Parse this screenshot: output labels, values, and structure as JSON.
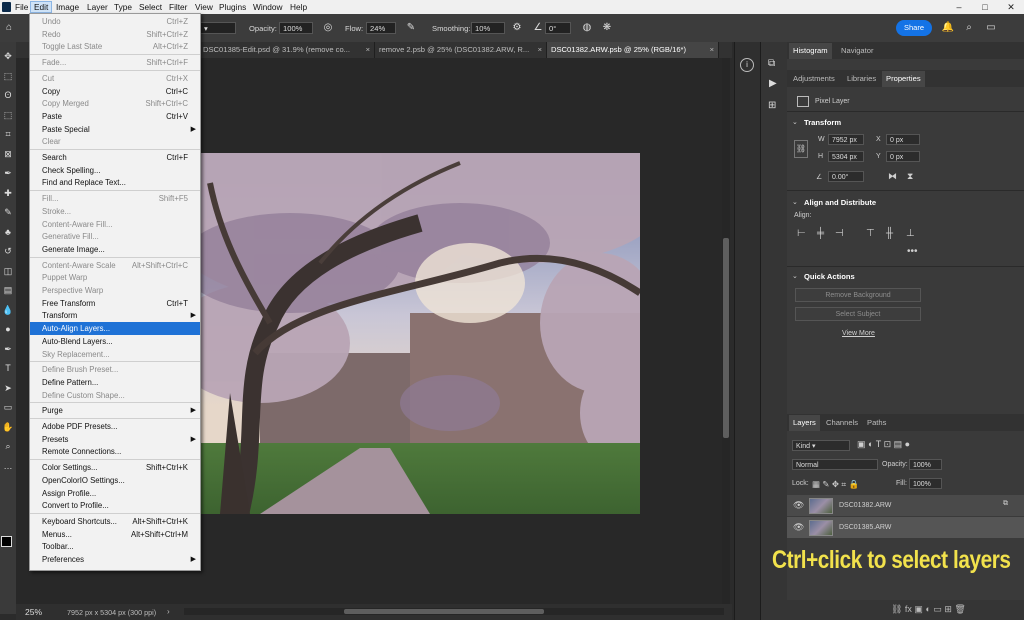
{
  "menubar": {
    "items": [
      "File",
      "Edit",
      "Image",
      "Layer",
      "Type",
      "Select",
      "Filter",
      "View",
      "Plugins",
      "Window",
      "Help"
    ],
    "window_controls": [
      "–",
      "□",
      "✕"
    ]
  },
  "options": {
    "opacity_label": "Opacity:",
    "opacity_value": "100%",
    "flow_label": "Flow:",
    "flow_value": "24%",
    "smoothing_label": "Smoothing:",
    "smoothing_value": "10%",
    "angle_value": "0°",
    "share_label": "Share"
  },
  "tabs": [
    {
      "label": "DSC01385-Edit.psd @ 31.9% (remove co...",
      "active": false
    },
    {
      "label": "remove 2.psb @ 25% (DSC01382.ARW, R...",
      "active": false
    },
    {
      "label": "DSC01382.ARW.psb @ 25% (RGB/16*)",
      "active": true
    }
  ],
  "status": {
    "zoom": "25%",
    "doc_info": "7952 px x 5304 px (300 ppi)"
  },
  "edit_menu": [
    {
      "label": "Undo",
      "shortcut": "Ctrl+Z",
      "disabled": true
    },
    {
      "label": "Redo",
      "shortcut": "Shift+Ctrl+Z",
      "disabled": true
    },
    {
      "label": "Toggle Last State",
      "shortcut": "Alt+Ctrl+Z",
      "disabled": true
    },
    {
      "sep": true
    },
    {
      "label": "Fade...",
      "shortcut": "Shift+Ctrl+F",
      "disabled": true
    },
    {
      "sep": true
    },
    {
      "label": "Cut",
      "shortcut": "Ctrl+X",
      "disabled": true
    },
    {
      "label": "Copy",
      "shortcut": "Ctrl+C",
      "disabled": false
    },
    {
      "label": "Copy Merged",
      "shortcut": "Shift+Ctrl+C",
      "disabled": true
    },
    {
      "label": "Paste",
      "shortcut": "Ctrl+V",
      "disabled": false
    },
    {
      "label": "Paste Special",
      "shortcut": "",
      "disabled": false,
      "submenu": true
    },
    {
      "label": "Clear",
      "shortcut": "",
      "disabled": true
    },
    {
      "sep": true
    },
    {
      "label": "Search",
      "shortcut": "Ctrl+F",
      "disabled": false
    },
    {
      "label": "Check Spelling...",
      "shortcut": "",
      "disabled": false
    },
    {
      "label": "Find and Replace Text...",
      "shortcut": "",
      "disabled": false
    },
    {
      "sep": true
    },
    {
      "label": "Fill...",
      "shortcut": "Shift+F5",
      "disabled": true
    },
    {
      "label": "Stroke...",
      "shortcut": "",
      "disabled": true
    },
    {
      "label": "Content-Aware Fill...",
      "shortcut": "",
      "disabled": true
    },
    {
      "label": "Generative Fill...",
      "shortcut": "",
      "disabled": true
    },
    {
      "label": "Generate Image...",
      "shortcut": "",
      "disabled": false
    },
    {
      "sep": true
    },
    {
      "label": "Content-Aware Scale",
      "shortcut": "Alt+Shift+Ctrl+C",
      "disabled": true
    },
    {
      "label": "Puppet Warp",
      "shortcut": "",
      "disabled": true
    },
    {
      "label": "Perspective Warp",
      "shortcut": "",
      "disabled": true
    },
    {
      "label": "Free Transform",
      "shortcut": "Ctrl+T",
      "disabled": false
    },
    {
      "label": "Transform",
      "shortcut": "",
      "disabled": false,
      "submenu": true
    },
    {
      "label": "Auto-Align Layers...",
      "shortcut": "",
      "disabled": false,
      "highlight": true
    },
    {
      "label": "Auto-Blend Layers...",
      "shortcut": "",
      "disabled": false
    },
    {
      "label": "Sky Replacement...",
      "shortcut": "",
      "disabled": true
    },
    {
      "sep": true
    },
    {
      "label": "Define Brush Preset...",
      "shortcut": "",
      "disabled": true
    },
    {
      "label": "Define Pattern...",
      "shortcut": "",
      "disabled": false
    },
    {
      "label": "Define Custom Shape...",
      "shortcut": "",
      "disabled": true
    },
    {
      "sep": true
    },
    {
      "label": "Purge",
      "shortcut": "",
      "disabled": false,
      "submenu": true
    },
    {
      "sep": true
    },
    {
      "label": "Adobe PDF Presets...",
      "shortcut": "",
      "disabled": false
    },
    {
      "label": "Presets",
      "shortcut": "",
      "disabled": false,
      "submenu": true
    },
    {
      "label": "Remote Connections...",
      "shortcut": "",
      "disabled": false
    },
    {
      "sep": true
    },
    {
      "label": "Color Settings...",
      "shortcut": "Shift+Ctrl+K",
      "disabled": false
    },
    {
      "label": "OpenColorIO Settings...",
      "shortcut": "",
      "disabled": false
    },
    {
      "label": "Assign Profile...",
      "shortcut": "",
      "disabled": false
    },
    {
      "label": "Convert to Profile...",
      "shortcut": "",
      "disabled": false
    },
    {
      "sep": true
    },
    {
      "label": "Keyboard Shortcuts...",
      "shortcut": "Alt+Shift+Ctrl+K",
      "disabled": false
    },
    {
      "label": "Menus...",
      "shortcut": "Alt+Shift+Ctrl+M",
      "disabled": false
    },
    {
      "label": "Toolbar...",
      "shortcut": "",
      "disabled": false
    },
    {
      "label": "Preferences",
      "shortcut": "",
      "disabled": false,
      "submenu": true
    }
  ],
  "panels": {
    "top_tabs": [
      "Histogram",
      "Navigator"
    ],
    "sub_tabs": [
      "Adjustments",
      "Libraries",
      "Properties"
    ],
    "pixel_layer": "Pixel Layer",
    "transform_title": "Transform",
    "w_label": "W",
    "w_value": "7952 px",
    "h_label": "H",
    "h_value": "5304 px",
    "x_label": "X",
    "x_value": "0 px",
    "y_label": "Y",
    "y_value": "0 px",
    "angle_value": "0.00°",
    "align_title": "Align and Distribute",
    "align_label": "Align:",
    "quick_title": "Quick Actions",
    "remove_bg": "Remove Background",
    "select_subject": "Select Subject",
    "view_more": "View More"
  },
  "layers_panel": {
    "tabs": [
      "Layers",
      "Channels",
      "Paths"
    ],
    "kind": "Kind",
    "blend_mode": "Normal",
    "opacity_label": "Opacity:",
    "opacity_value": "100%",
    "lock_label": "Lock:",
    "fill_label": "Fill:",
    "fill_value": "100%",
    "layers": [
      "DSC01382.ARW",
      "DSC01385.ARW"
    ]
  },
  "caption": "Ctrl+click to select layers"
}
